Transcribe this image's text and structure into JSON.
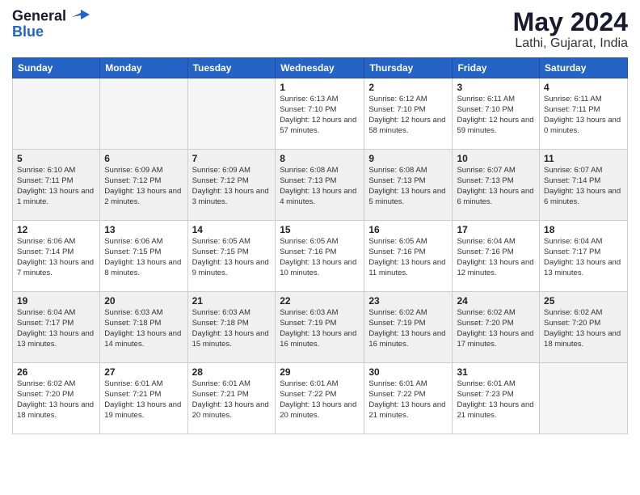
{
  "logo": {
    "line1": "General",
    "line2": "Blue"
  },
  "title": "May 2024",
  "location": "Lathi, Gujarat, India",
  "days_of_week": [
    "Sunday",
    "Monday",
    "Tuesday",
    "Wednesday",
    "Thursday",
    "Friday",
    "Saturday"
  ],
  "weeks": [
    [
      {
        "day": "",
        "info": ""
      },
      {
        "day": "",
        "info": ""
      },
      {
        "day": "",
        "info": ""
      },
      {
        "day": "1",
        "info": "Sunrise: 6:13 AM\nSunset: 7:10 PM\nDaylight: 12 hours and 57 minutes."
      },
      {
        "day": "2",
        "info": "Sunrise: 6:12 AM\nSunset: 7:10 PM\nDaylight: 12 hours and 58 minutes."
      },
      {
        "day": "3",
        "info": "Sunrise: 6:11 AM\nSunset: 7:10 PM\nDaylight: 12 hours and 59 minutes."
      },
      {
        "day": "4",
        "info": "Sunrise: 6:11 AM\nSunset: 7:11 PM\nDaylight: 13 hours and 0 minutes."
      }
    ],
    [
      {
        "day": "5",
        "info": "Sunrise: 6:10 AM\nSunset: 7:11 PM\nDaylight: 13 hours and 1 minute."
      },
      {
        "day": "6",
        "info": "Sunrise: 6:09 AM\nSunset: 7:12 PM\nDaylight: 13 hours and 2 minutes."
      },
      {
        "day": "7",
        "info": "Sunrise: 6:09 AM\nSunset: 7:12 PM\nDaylight: 13 hours and 3 minutes."
      },
      {
        "day": "8",
        "info": "Sunrise: 6:08 AM\nSunset: 7:13 PM\nDaylight: 13 hours and 4 minutes."
      },
      {
        "day": "9",
        "info": "Sunrise: 6:08 AM\nSunset: 7:13 PM\nDaylight: 13 hours and 5 minutes."
      },
      {
        "day": "10",
        "info": "Sunrise: 6:07 AM\nSunset: 7:13 PM\nDaylight: 13 hours and 6 minutes."
      },
      {
        "day": "11",
        "info": "Sunrise: 6:07 AM\nSunset: 7:14 PM\nDaylight: 13 hours and 6 minutes."
      }
    ],
    [
      {
        "day": "12",
        "info": "Sunrise: 6:06 AM\nSunset: 7:14 PM\nDaylight: 13 hours and 7 minutes."
      },
      {
        "day": "13",
        "info": "Sunrise: 6:06 AM\nSunset: 7:15 PM\nDaylight: 13 hours and 8 minutes."
      },
      {
        "day": "14",
        "info": "Sunrise: 6:05 AM\nSunset: 7:15 PM\nDaylight: 13 hours and 9 minutes."
      },
      {
        "day": "15",
        "info": "Sunrise: 6:05 AM\nSunset: 7:16 PM\nDaylight: 13 hours and 10 minutes."
      },
      {
        "day": "16",
        "info": "Sunrise: 6:05 AM\nSunset: 7:16 PM\nDaylight: 13 hours and 11 minutes."
      },
      {
        "day": "17",
        "info": "Sunrise: 6:04 AM\nSunset: 7:16 PM\nDaylight: 13 hours and 12 minutes."
      },
      {
        "day": "18",
        "info": "Sunrise: 6:04 AM\nSunset: 7:17 PM\nDaylight: 13 hours and 13 minutes."
      }
    ],
    [
      {
        "day": "19",
        "info": "Sunrise: 6:04 AM\nSunset: 7:17 PM\nDaylight: 13 hours and 13 minutes."
      },
      {
        "day": "20",
        "info": "Sunrise: 6:03 AM\nSunset: 7:18 PM\nDaylight: 13 hours and 14 minutes."
      },
      {
        "day": "21",
        "info": "Sunrise: 6:03 AM\nSunset: 7:18 PM\nDaylight: 13 hours and 15 minutes."
      },
      {
        "day": "22",
        "info": "Sunrise: 6:03 AM\nSunset: 7:19 PM\nDaylight: 13 hours and 16 minutes."
      },
      {
        "day": "23",
        "info": "Sunrise: 6:02 AM\nSunset: 7:19 PM\nDaylight: 13 hours and 16 minutes."
      },
      {
        "day": "24",
        "info": "Sunrise: 6:02 AM\nSunset: 7:20 PM\nDaylight: 13 hours and 17 minutes."
      },
      {
        "day": "25",
        "info": "Sunrise: 6:02 AM\nSunset: 7:20 PM\nDaylight: 13 hours and 18 minutes."
      }
    ],
    [
      {
        "day": "26",
        "info": "Sunrise: 6:02 AM\nSunset: 7:20 PM\nDaylight: 13 hours and 18 minutes."
      },
      {
        "day": "27",
        "info": "Sunrise: 6:01 AM\nSunset: 7:21 PM\nDaylight: 13 hours and 19 minutes."
      },
      {
        "day": "28",
        "info": "Sunrise: 6:01 AM\nSunset: 7:21 PM\nDaylight: 13 hours and 20 minutes."
      },
      {
        "day": "29",
        "info": "Sunrise: 6:01 AM\nSunset: 7:22 PM\nDaylight: 13 hours and 20 minutes."
      },
      {
        "day": "30",
        "info": "Sunrise: 6:01 AM\nSunset: 7:22 PM\nDaylight: 13 hours and 21 minutes."
      },
      {
        "day": "31",
        "info": "Sunrise: 6:01 AM\nSunset: 7:23 PM\nDaylight: 13 hours and 21 minutes."
      },
      {
        "day": "",
        "info": ""
      }
    ]
  ],
  "shaded_rows": [
    1,
    3
  ]
}
